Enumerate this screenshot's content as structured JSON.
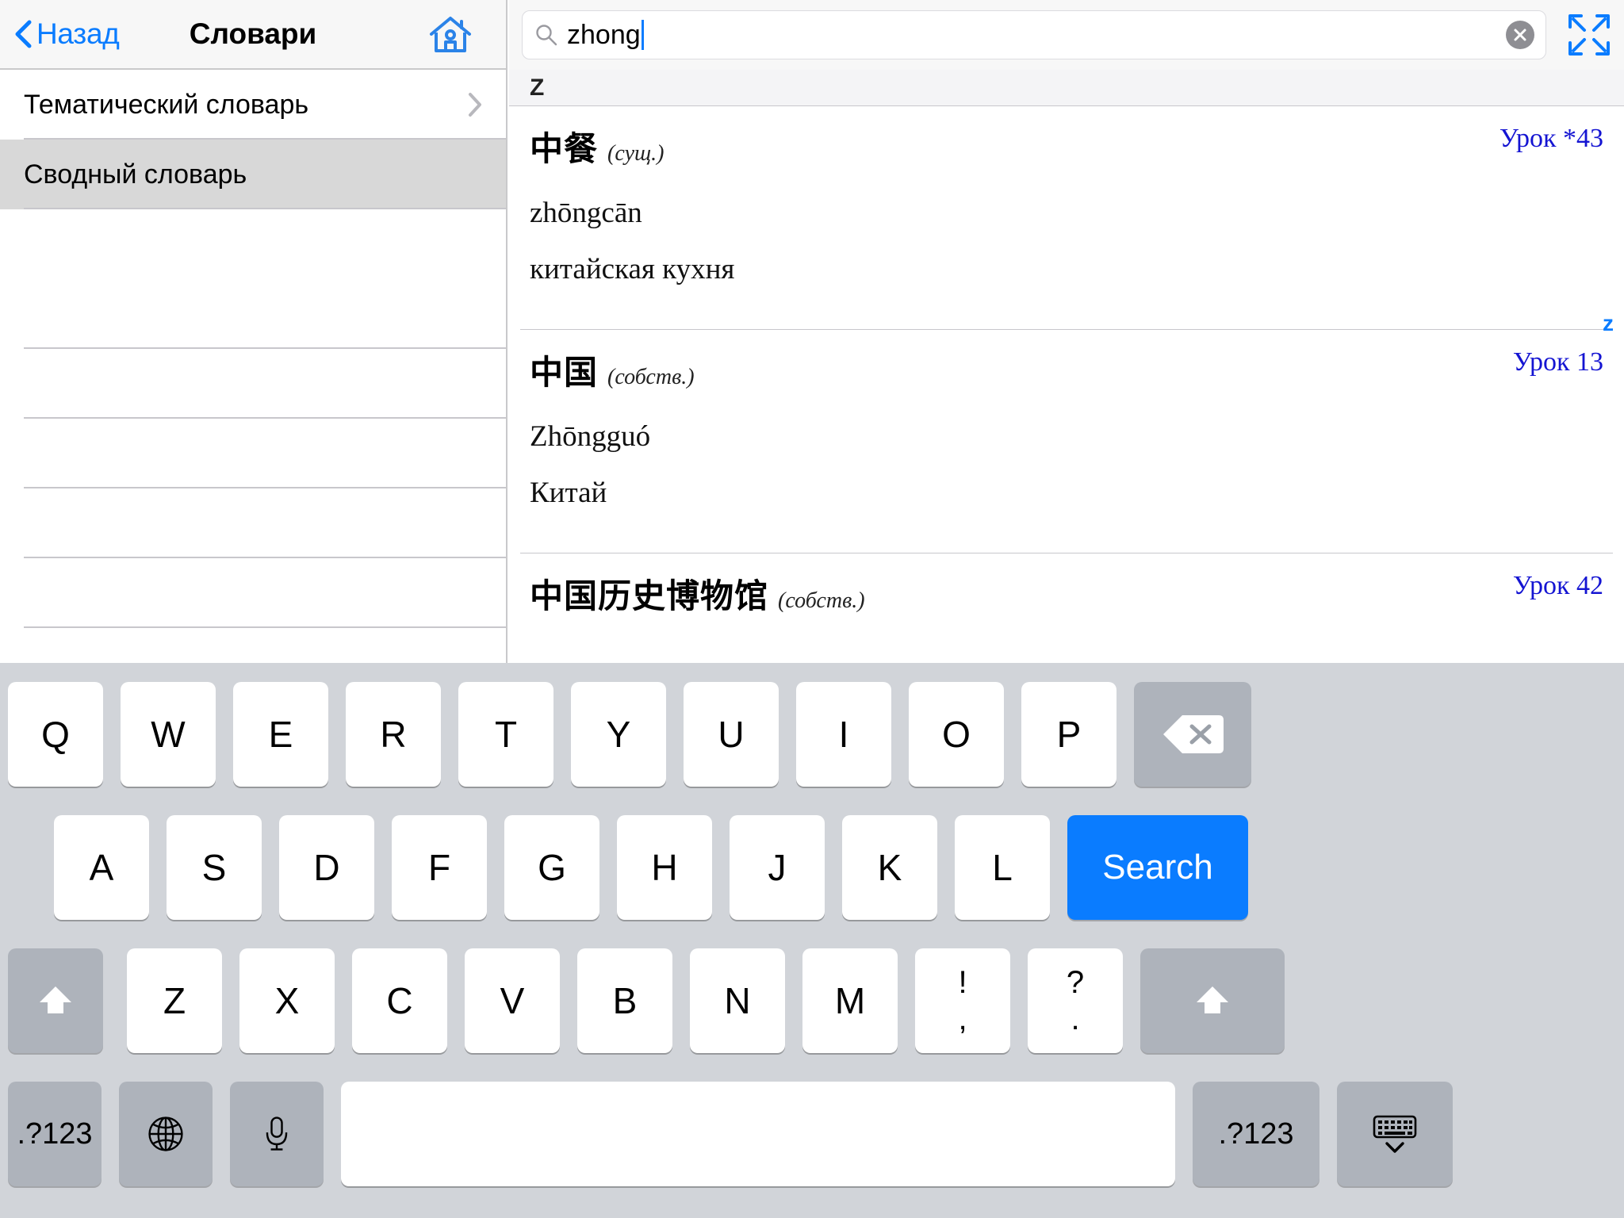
{
  "sidebar": {
    "nav": {
      "back_label": "Назад",
      "title": "Словари",
      "back_icon": "chevron-left-icon",
      "home_icon": "home-icon"
    },
    "items": [
      {
        "label": "Тематический словарь",
        "selected": false,
        "has_chevron": true
      },
      {
        "label": "Сводный словарь",
        "selected": true,
        "has_chevron": false
      }
    ],
    "empty_row_count": 7
  },
  "search": {
    "value": "zhong",
    "placeholder": "",
    "search_icon": "search-icon",
    "clear_icon": "clear-circle-icon",
    "expand_icon": "expand-fullscreen-icon"
  },
  "results": {
    "section_letter": "Z",
    "index_letter": "z",
    "entries": [
      {
        "hanzi": "中餐",
        "pos": "(сущ.)",
        "lesson": "Урок *43",
        "pinyin": "zhōngcān",
        "gloss": "китайская кухня"
      },
      {
        "hanzi": "中国",
        "pos": "(собств.)",
        "lesson": "Урок 13",
        "pinyin": "Zhōngguó",
        "gloss": "Китай"
      },
      {
        "hanzi": "中国历史博物馆",
        "pos": "(собств.)",
        "lesson": "Урок 42",
        "pinyin": "",
        "gloss": ""
      }
    ]
  },
  "keyboard": {
    "row1": [
      "Q",
      "W",
      "E",
      "R",
      "T",
      "Y",
      "U",
      "I",
      "O",
      "P"
    ],
    "row2": [
      "A",
      "S",
      "D",
      "F",
      "G",
      "H",
      "J",
      "K",
      "L"
    ],
    "row3": [
      "Z",
      "X",
      "C",
      "V",
      "B",
      "N",
      "M"
    ],
    "backspace_icon": "backspace-icon",
    "search_label": "Search",
    "shift_left_icon": "shift-icon",
    "shift_right_icon": "shift-icon",
    "punct_excl": "!",
    "punct_comma": ",",
    "punct_quest": "?",
    "punct_period": ".",
    "numbers_left_label": ".?123",
    "numbers_right_label": ".?123",
    "globe_icon": "globe-icon",
    "mic_icon": "microphone-icon",
    "space_label": "",
    "dismiss_icon": "hide-keyboard-icon"
  },
  "colors": {
    "accent": "#0a7cff",
    "lesson_blue": "#1414d2",
    "keyboard_bg": "#d1d4d9",
    "key_dark": "#aeb3bb",
    "selected_row": "#d8d8d8"
  }
}
